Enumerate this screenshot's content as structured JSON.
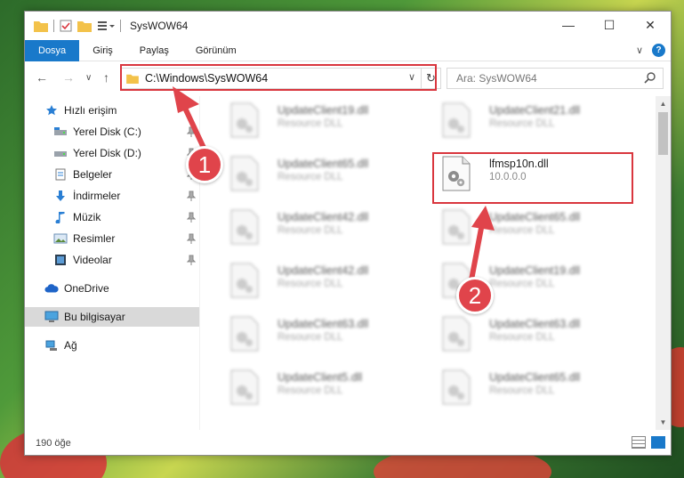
{
  "window": {
    "title": "SysWOW64",
    "controls": {
      "minimize": "—",
      "maximize": "☐",
      "close": "✕"
    }
  },
  "ribbon": {
    "tabs": [
      {
        "label": "Dosya",
        "active": true
      },
      {
        "label": "Giriş"
      },
      {
        "label": "Paylaş"
      },
      {
        "label": "Görünüm"
      }
    ],
    "expand": "∨",
    "help": "?"
  },
  "nav": {
    "back": "←",
    "forward": "→",
    "recent": "∨",
    "up": "↑",
    "address": "C:\\Windows\\SysWOW64",
    "address_dropdown": "∨",
    "refresh": "↻",
    "search_placeholder": "Ara: SysWOW64"
  },
  "sidebar": {
    "items": [
      {
        "label": "Hızlı erişim",
        "icon": "star-icon"
      },
      {
        "label": "Yerel Disk (C:)",
        "icon": "drive-icon"
      },
      {
        "label": "Yerel Disk (D:)",
        "icon": "drive-icon"
      },
      {
        "label": "Belgeler",
        "icon": "documents-icon"
      },
      {
        "label": "İndirmeler",
        "icon": "download-icon"
      },
      {
        "label": "Müzik",
        "icon": "music-icon"
      },
      {
        "label": "Resimler",
        "icon": "pictures-icon"
      },
      {
        "label": "Videolar",
        "icon": "video-icon"
      },
      {
        "label": "OneDrive",
        "icon": "cloud-icon"
      },
      {
        "label": "Bu bilgisayar",
        "icon": "computer-icon"
      },
      {
        "label": "Ağ",
        "icon": "network-icon"
      }
    ]
  },
  "files": [
    {
      "name": "UpdateClient19.dll",
      "desc": "Resource DLL"
    },
    {
      "name": "UpdateClient21.dll",
      "desc": "Resource DLL"
    },
    {
      "name": "UpdateClient65.dll",
      "desc": "Resource DLL"
    },
    {
      "name": "lfmsp10n.dll",
      "desc": "10.0.0.0"
    },
    {
      "name": "UpdateClient42.dll",
      "desc": "Resource DLL"
    },
    {
      "name": "UpdateClient65.dll",
      "desc": "Resource DLL"
    },
    {
      "name": "UpdateClient42.dll",
      "desc": "Resource DLL"
    },
    {
      "name": "UpdateClient19.dll",
      "desc": "Resource DLL"
    },
    {
      "name": "UpdateClient63.dll",
      "desc": "Resource DLL"
    },
    {
      "name": "UpdateClient63.dll",
      "desc": "Resource DLL"
    },
    {
      "name": "UpdateClient5.dll",
      "desc": "Resource DLL"
    },
    {
      "name": "UpdateClient65.dll",
      "desc": "Resource DLL"
    }
  ],
  "status": {
    "count": "190 öğe"
  },
  "callouts": {
    "one": "1",
    "two": "2"
  },
  "colors": {
    "accent": "#1979ca",
    "highlight": "#d9363e",
    "callout": "#e0444b"
  }
}
